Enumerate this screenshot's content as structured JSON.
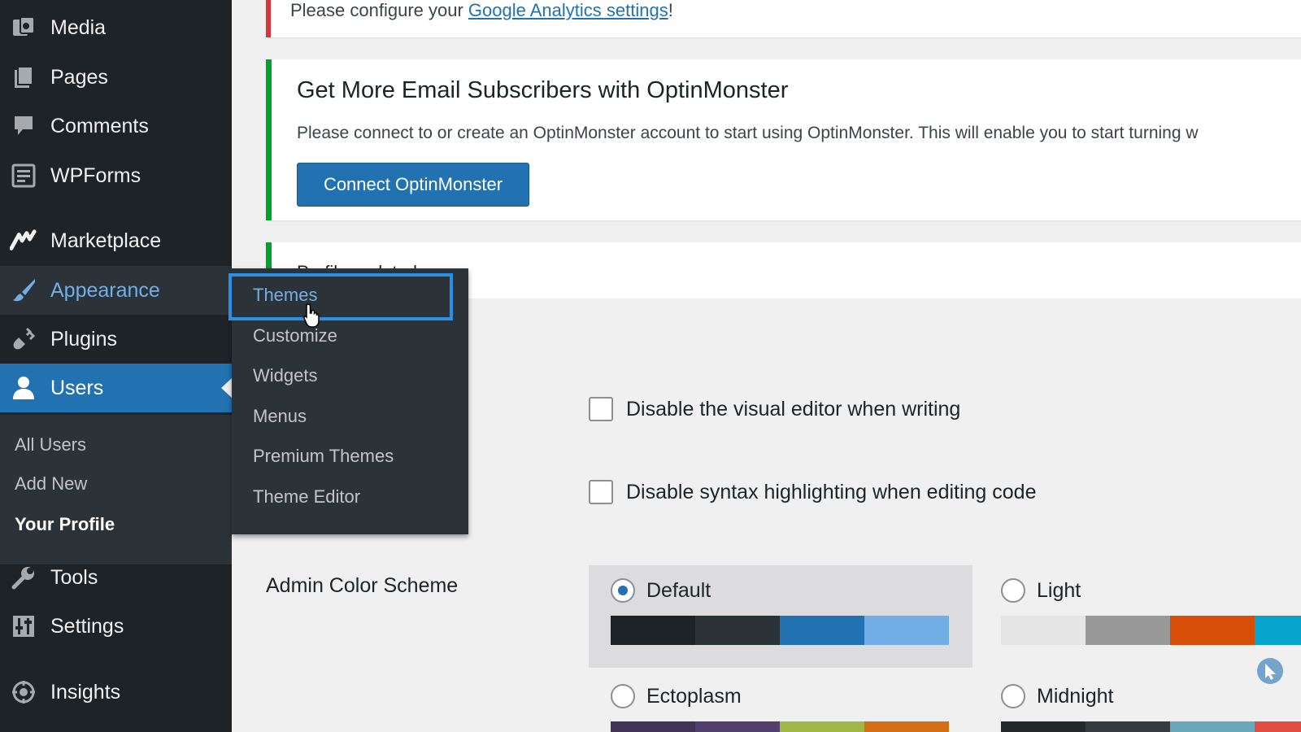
{
  "sidebar": {
    "items": [
      {
        "label": "Media",
        "icon": "media-icon"
      },
      {
        "label": "Pages",
        "icon": "pages-icon"
      },
      {
        "label": "Comments",
        "icon": "comments-icon"
      },
      {
        "label": "WPForms",
        "icon": "wpforms-icon"
      },
      {
        "label": "Marketplace",
        "icon": "marketplace-icon"
      },
      {
        "label": "Appearance",
        "icon": "appearance-brush-icon"
      },
      {
        "label": "Plugins",
        "icon": "plugins-icon"
      },
      {
        "label": "Users",
        "icon": "users-icon"
      },
      {
        "label": "Tools",
        "icon": "tools-wrench-icon"
      },
      {
        "label": "Settings",
        "icon": "settings-icon"
      },
      {
        "label": "Insights",
        "icon": "insights-icon"
      }
    ],
    "users_submenu": [
      "All Users",
      "Add New",
      "Your Profile"
    ]
  },
  "appearance_flyout": {
    "items": [
      "Themes",
      "Customize",
      "Widgets",
      "Menus",
      "Premium Themes",
      "Theme Editor"
    ]
  },
  "notices": {
    "analytics_prefix": "Please configure your ",
    "analytics_link": "Google Analytics settings",
    "analytics_suffix": "!",
    "om_title": "Get More Email Subscribers with OptinMonster",
    "om_desc": "Please connect to or create an OptinMonster account to start using OptinMonster. This will enable you to start turning w",
    "om_button": "Connect OptinMonster",
    "profile_updated": "Profile updated."
  },
  "options": {
    "visual_editor": "Disable the visual editor when writing",
    "syntax_highlighting": "Disable syntax highlighting when editing code",
    "color_scheme_label": "Admin Color Scheme"
  },
  "schemes": [
    {
      "name": "Default",
      "selected": true,
      "colors": [
        "#1d2327",
        "#2c3338",
        "#2271b1",
        "#72aee6"
      ]
    },
    {
      "name": "Light",
      "selected": false,
      "colors": [
        "#e5e5e5",
        "#999999",
        "#d64e07",
        "#04a4cc"
      ]
    },
    {
      "name": "Ectoplasm",
      "selected": false,
      "colors": [
        "#413256",
        "#523f6d",
        "#a3b745",
        "#d46f15"
      ]
    },
    {
      "name": "Midnight",
      "selected": false,
      "colors": [
        "#25282b",
        "#363b3f",
        "#69a8bb",
        "#e14d43"
      ]
    }
  ],
  "colors": {
    "sidebar_bg": "#1d2327",
    "accent_blue": "#2271b1",
    "hover_blue": "#72aee6",
    "success_green": "#00a32a",
    "error_red": "#d63638"
  }
}
